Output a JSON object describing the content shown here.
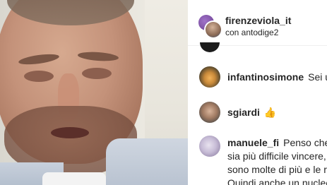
{
  "header": {
    "username": "firenzeviola_it",
    "subtitle": "con antodige2"
  },
  "comments": [
    {
      "username": "infantinosimone",
      "text": "Sei un"
    },
    {
      "username": "sgiardi",
      "text": "👍"
    },
    {
      "username": "manuele_fi",
      "text": "Penso che",
      "lines": [
        "sia più difficile vincere,",
        "sono molte di più e le ro",
        "Quindi anche un nucleo"
      ]
    }
  ],
  "colors": {
    "text": "#262626",
    "panel_bg": "#ffffff",
    "emoji_thumb": "#f2b526"
  },
  "icons": [
    "host-avatar-icon",
    "guest-avatar-icon",
    "commenter-avatar-icon"
  ]
}
